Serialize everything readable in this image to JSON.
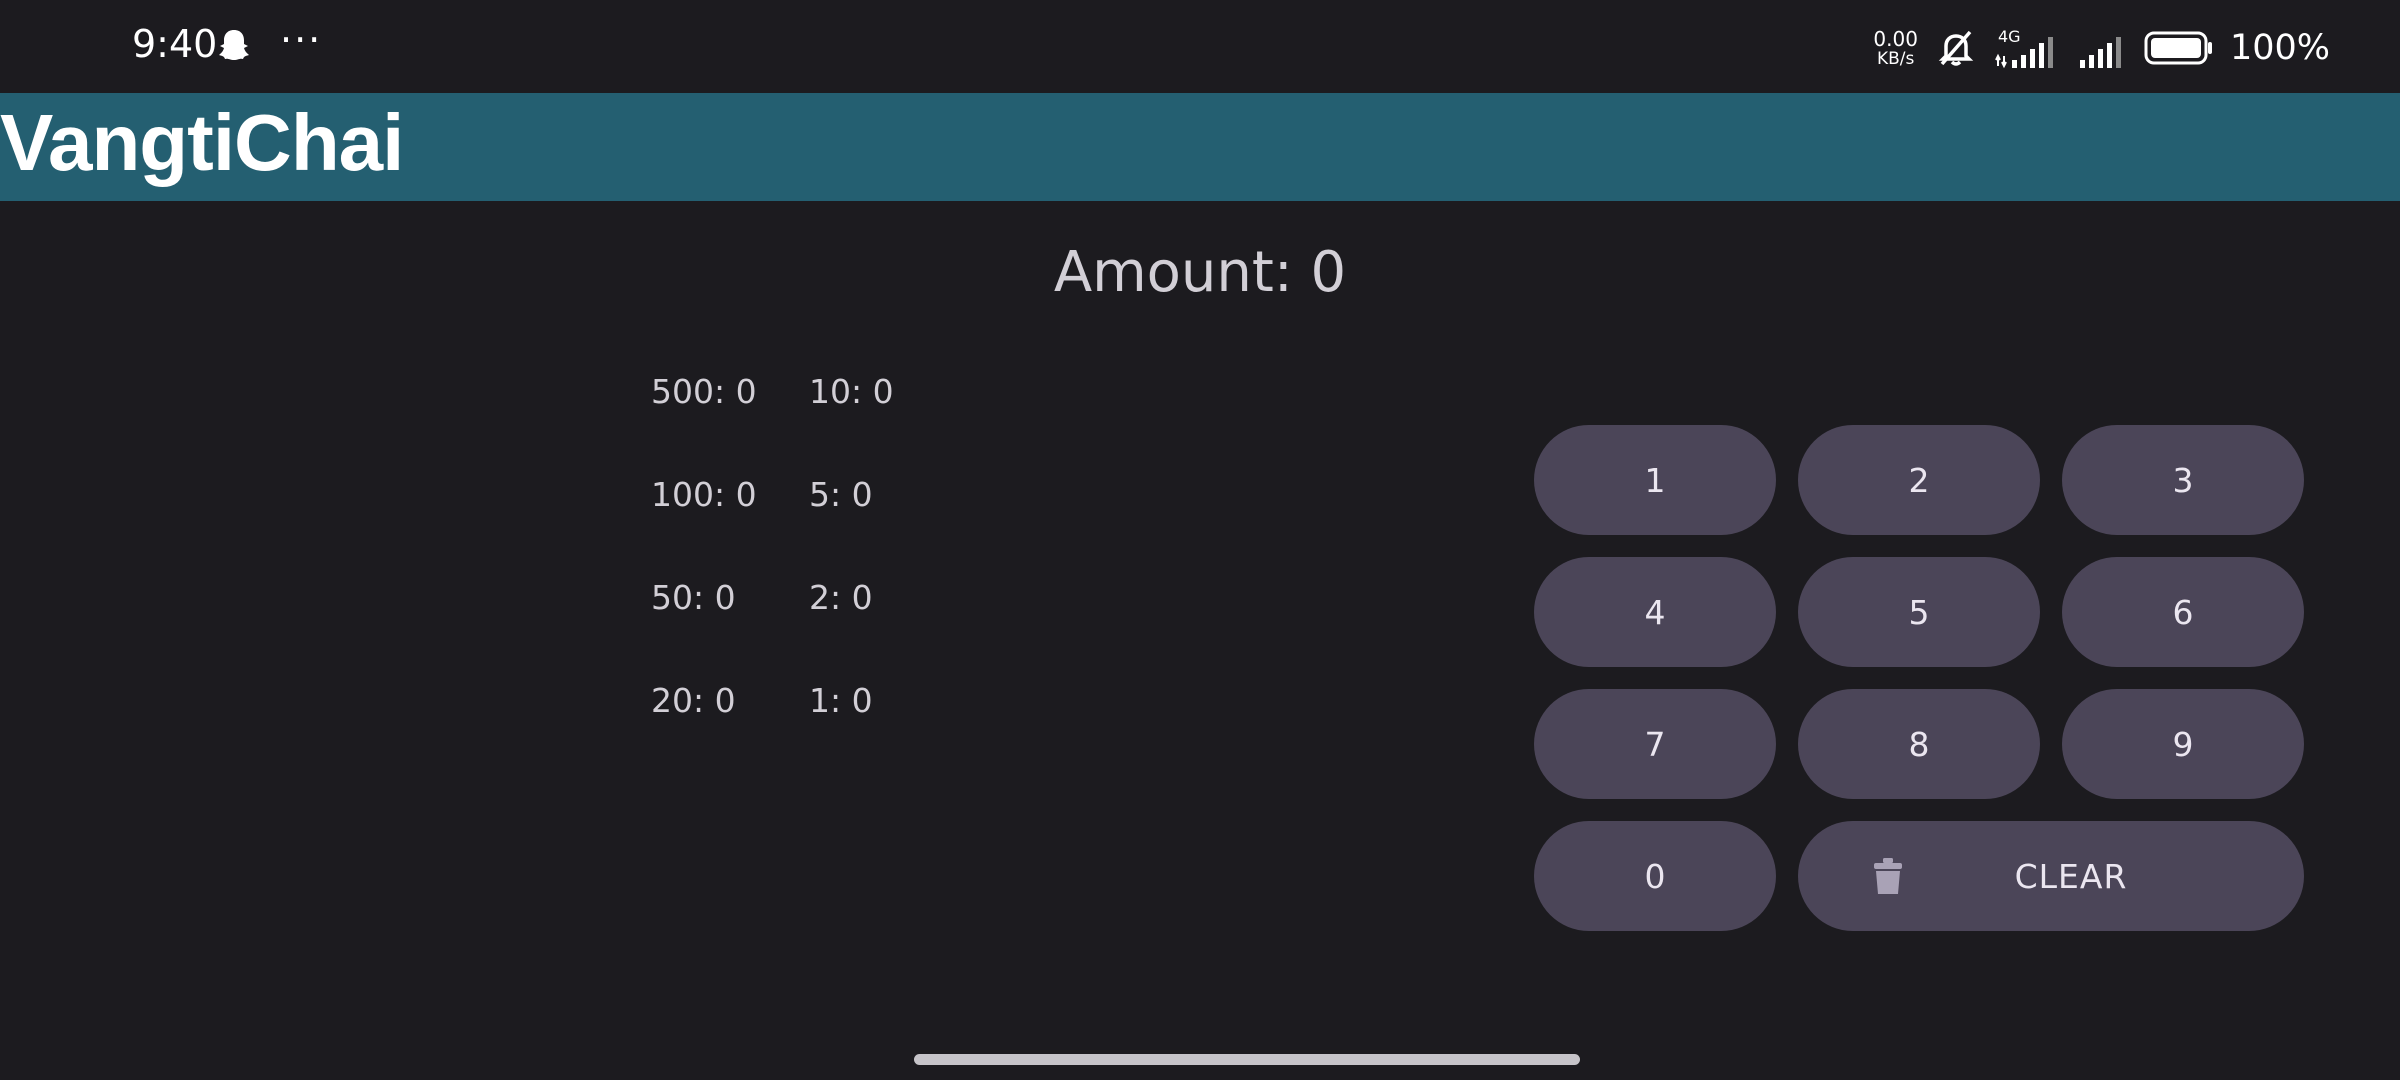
{
  "status_bar": {
    "time": "9:40",
    "more": "···",
    "net_speed_value": "0.00",
    "net_speed_unit": "KB/s",
    "network_type": "4G",
    "battery_percent": "100%"
  },
  "app_bar": {
    "title": "VangtiChai"
  },
  "amount": {
    "label": "Amount: 0"
  },
  "breakdown": {
    "left_column": [
      "500: 0",
      "100: 0",
      "50: 0",
      "20: 0"
    ],
    "right_column": [
      "10: 0",
      "5: 0",
      "2: 0",
      "1: 0"
    ]
  },
  "keypad": {
    "keys": [
      "1",
      "2",
      "3",
      "4",
      "5",
      "6",
      "7",
      "8",
      "9",
      "0"
    ],
    "clear_label": "CLEAR"
  },
  "colors": {
    "background": "#1c1b1f",
    "app_bar": "#245f71",
    "key": "#4b4558",
    "text": "#d2cfd6"
  },
  "icons": {
    "status": [
      "snapchat-ghost-icon",
      "mute-icon",
      "signal-icon",
      "battery-icon"
    ],
    "clear": "trash-icon"
  }
}
